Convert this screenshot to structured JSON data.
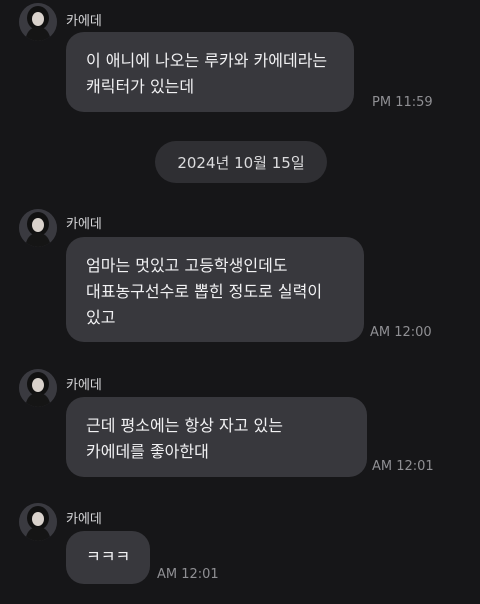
{
  "chat": {
    "date_separator": "2024년 10월 15일",
    "messages": [
      {
        "sender": "카에데",
        "lines": [
          "이 애니에 나오는 루카와 카에데라는",
          "캐릭터가 있는데"
        ],
        "time": "PM 11:59"
      },
      {
        "sender": "카에데",
        "lines": [
          "엄마는 멋있고 고등학생인데도",
          "대표농구선수로 뽑힌 정도로 실력이",
          "있고"
        ],
        "time": "AM 12:00"
      },
      {
        "sender": "카에데",
        "lines": [
          "근데 평소에는 항상 자고 있는",
          "카에데를 좋아한대"
        ],
        "time": "AM 12:01"
      },
      {
        "sender": "카에데",
        "lines": [
          "ㅋㅋㅋ"
        ],
        "time": "AM 12:01"
      }
    ]
  },
  "icons": {
    "avatar": "profile-avatar-icon"
  },
  "colors": {
    "background": "#161618",
    "bubble": "#38383d",
    "date_chip": "#2f2f33",
    "timestamp": "#8f8f93"
  }
}
